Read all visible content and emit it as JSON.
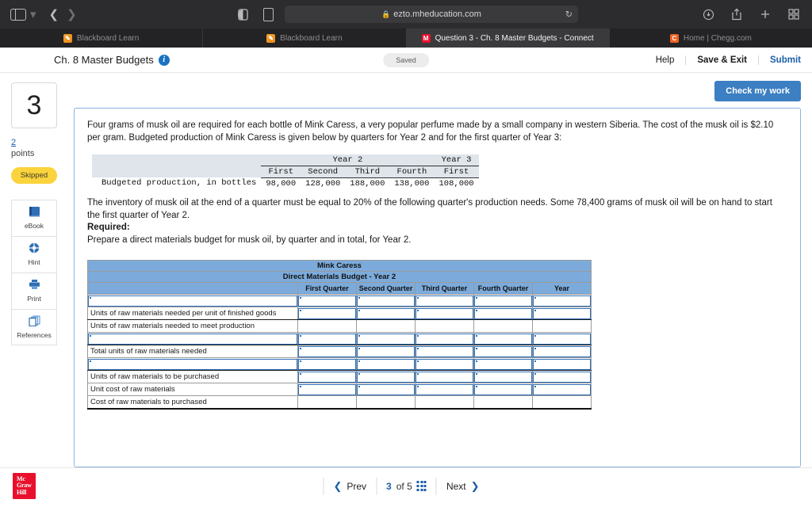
{
  "browser": {
    "url": "ezto.mheducation.com",
    "lock_icon": "lock-icon",
    "reload_icon": "reload-icon",
    "tabs": [
      {
        "label": "Blackboard Learn",
        "favicon": "blackboard-icon",
        "favicon_glyph": "✎",
        "active": false
      },
      {
        "label": "Blackboard Learn",
        "favicon": "blackboard-icon",
        "favicon_glyph": "✎",
        "active": false
      },
      {
        "label": "Question 3 - Ch. 8 Master Budgets - Connect",
        "favicon": "mcgrawhill-icon",
        "favicon_glyph": "M",
        "active": true
      },
      {
        "label": "Home | Chegg.com",
        "favicon": "chegg-icon",
        "favicon_glyph": "C",
        "active": false
      }
    ]
  },
  "header": {
    "title": "Ch. 8 Master Budgets",
    "info_icon": "info-icon",
    "status": "Saved",
    "help": "Help",
    "save_exit": "Save & Exit",
    "submit": "Submit"
  },
  "question_sidebar": {
    "number": "3",
    "points_value": "2",
    "points_label": "points",
    "status_badge": "Skipped",
    "tools": [
      {
        "label": "eBook",
        "icon": "book-icon"
      },
      {
        "label": "Hint",
        "icon": "lifebuoy-icon"
      },
      {
        "label": "Print",
        "icon": "printer-icon"
      },
      {
        "label": "References",
        "icon": "copy-stack-icon"
      }
    ]
  },
  "main": {
    "check_my_work": "Check my work",
    "paragraph1": "Four grams of musk oil are required for each bottle of Mink Caress, a very popular perfume made by a small company in western Siberia. The cost of the musk oil is $2.10 per gram. Budgeted production of Mink Caress is given below by quarters for Year 2 and for the first quarter of Year 3:",
    "paragraph2": "The inventory of musk oil at the end of a quarter must be equal to 20% of the following quarter's production needs. Some 78,400 grams of musk oil will be on hand to start the first quarter of Year 2.",
    "required_label": "Required:",
    "required_text": "Prepare a direct materials budget for musk oil, by quarter and in total, for Year 2."
  },
  "given_table": {
    "year_groups": [
      {
        "label": "Year 2",
        "span": 4
      },
      {
        "label": "Year 3",
        "span": 1
      }
    ],
    "quarter_headers": [
      "First",
      "Second",
      "Third",
      "Fourth",
      "First"
    ],
    "row_label": "Budgeted production, in bottles",
    "values": [
      "98,000",
      "128,000",
      "188,000",
      "138,000",
      "108,000"
    ]
  },
  "answer_table": {
    "title": "Mink Caress",
    "subtitle": "Direct Materials Budget - Year 2",
    "columns": [
      "First Quarter",
      "Second Quarter",
      "Third Quarter",
      "Fourth Quarter",
      "Year"
    ],
    "rows": [
      {
        "label": "",
        "label_editable": true,
        "inputs": true,
        "thick_bottom": false
      },
      {
        "label": "Units of raw materials needed per unit of finished goods",
        "label_editable": false,
        "inputs": true,
        "thick_bottom": true
      },
      {
        "label": "Units of raw materials needed to meet production",
        "label_editable": false,
        "inputs": false,
        "thick_bottom": false
      },
      {
        "label": "",
        "label_editable": true,
        "inputs": true,
        "thick_bottom": true
      },
      {
        "label": "Total units of raw materials needed",
        "label_editable": false,
        "inputs": true,
        "thick_bottom": false
      },
      {
        "label": "",
        "label_editable": true,
        "inputs": true,
        "thick_bottom": true
      },
      {
        "label": "Units of raw materials to be purchased",
        "label_editable": false,
        "inputs": true,
        "thick_bottom": false
      },
      {
        "label": "Unit cost of raw materials",
        "label_editable": false,
        "inputs": true,
        "thick_bottom": false
      },
      {
        "label": "Cost of raw materials to purchased",
        "label_editable": false,
        "inputs": false,
        "thick_bottom": false
      }
    ]
  },
  "footer": {
    "logo_line1": "Mc",
    "logo_line2": "Graw",
    "logo_line3": "Hill",
    "prev": "Prev",
    "current_page": "3",
    "of_text": "of 5",
    "next": "Next",
    "grid_icon": "grid-icon"
  }
}
